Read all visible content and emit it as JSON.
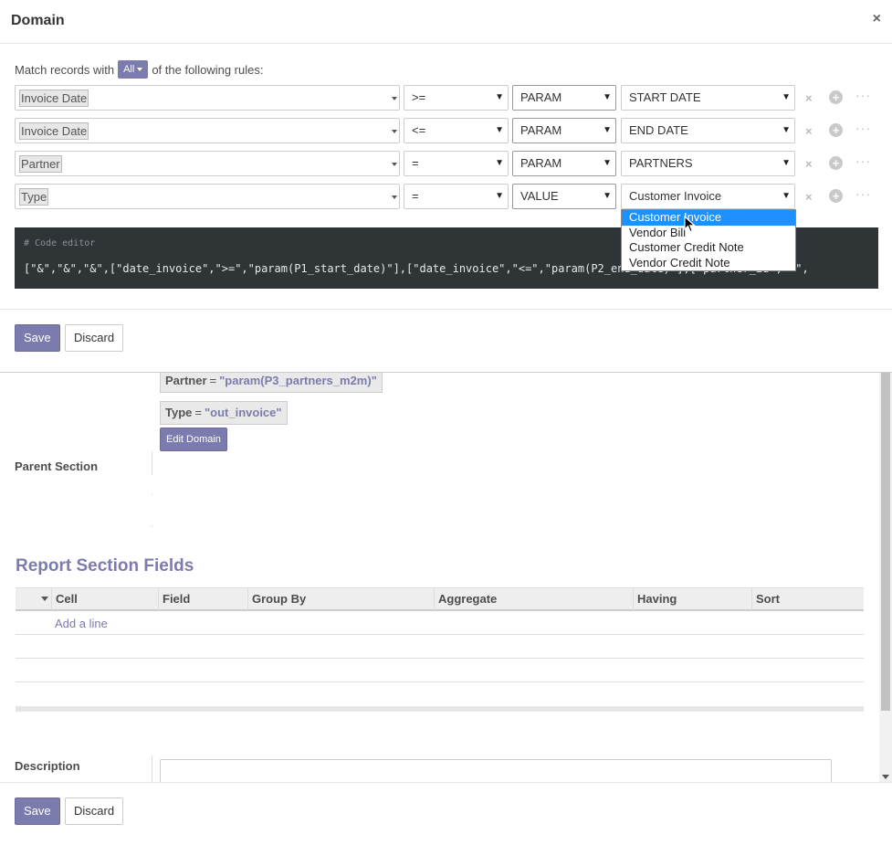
{
  "dialog": {
    "title": "Domain",
    "close_symbol": "×"
  },
  "match": {
    "prefix": "Match records with",
    "mode": "All",
    "suffix": "of the following rules:"
  },
  "rules": [
    {
      "field": "Invoice Date",
      "operator": ">=",
      "type": "PARAM",
      "value": "START DATE"
    },
    {
      "field": "Invoice Date",
      "operator": "<=",
      "type": "PARAM",
      "value": "END DATE"
    },
    {
      "field": "Partner",
      "operator": "=",
      "type": "PARAM",
      "value": "PARTNERS"
    },
    {
      "field": "Type",
      "operator": "=",
      "type": "VALUE",
      "value": "Customer Invoice"
    }
  ],
  "row_icons": {
    "remove": "×",
    "add": "+",
    "more": "···"
  },
  "code_editor": {
    "comment": "# Code editor",
    "code": "[\"&\",\"&\",\"&\",[\"date_invoice\",\">=\",\"param(P1_start_date)\"],[\"date_invoice\",\"<=\",\"param(P2_end_date)\"],[\"partner_id\",\"=\","
  },
  "buttons": {
    "save": "Save",
    "discard": "Discard"
  },
  "dropdown": {
    "options": [
      "Customer Invoice",
      "Vendor Bill",
      "Customer Credit Note",
      "Vendor Credit Note"
    ],
    "selected": "Customer Invoice"
  },
  "form": {
    "domain_chips": [
      {
        "key": "Partner",
        "op": "=",
        "value": "\"param(P3_partners_m2m)\""
      },
      {
        "key": "Type",
        "op": "=",
        "value": "\"out_invoice\""
      }
    ],
    "edit_domain": "Edit Domain",
    "parent_section_label": "Parent Section",
    "fields_title": "Report Section Fields",
    "columns": [
      "Cell",
      "Field",
      "Group By",
      "Aggregate",
      "Having",
      "Sort"
    ],
    "add_line": "Add a line",
    "description_label": "Description"
  },
  "colors": {
    "accent": "#7c7bad",
    "code_bg": "#2f3437",
    "selection": "#1e90ff"
  }
}
